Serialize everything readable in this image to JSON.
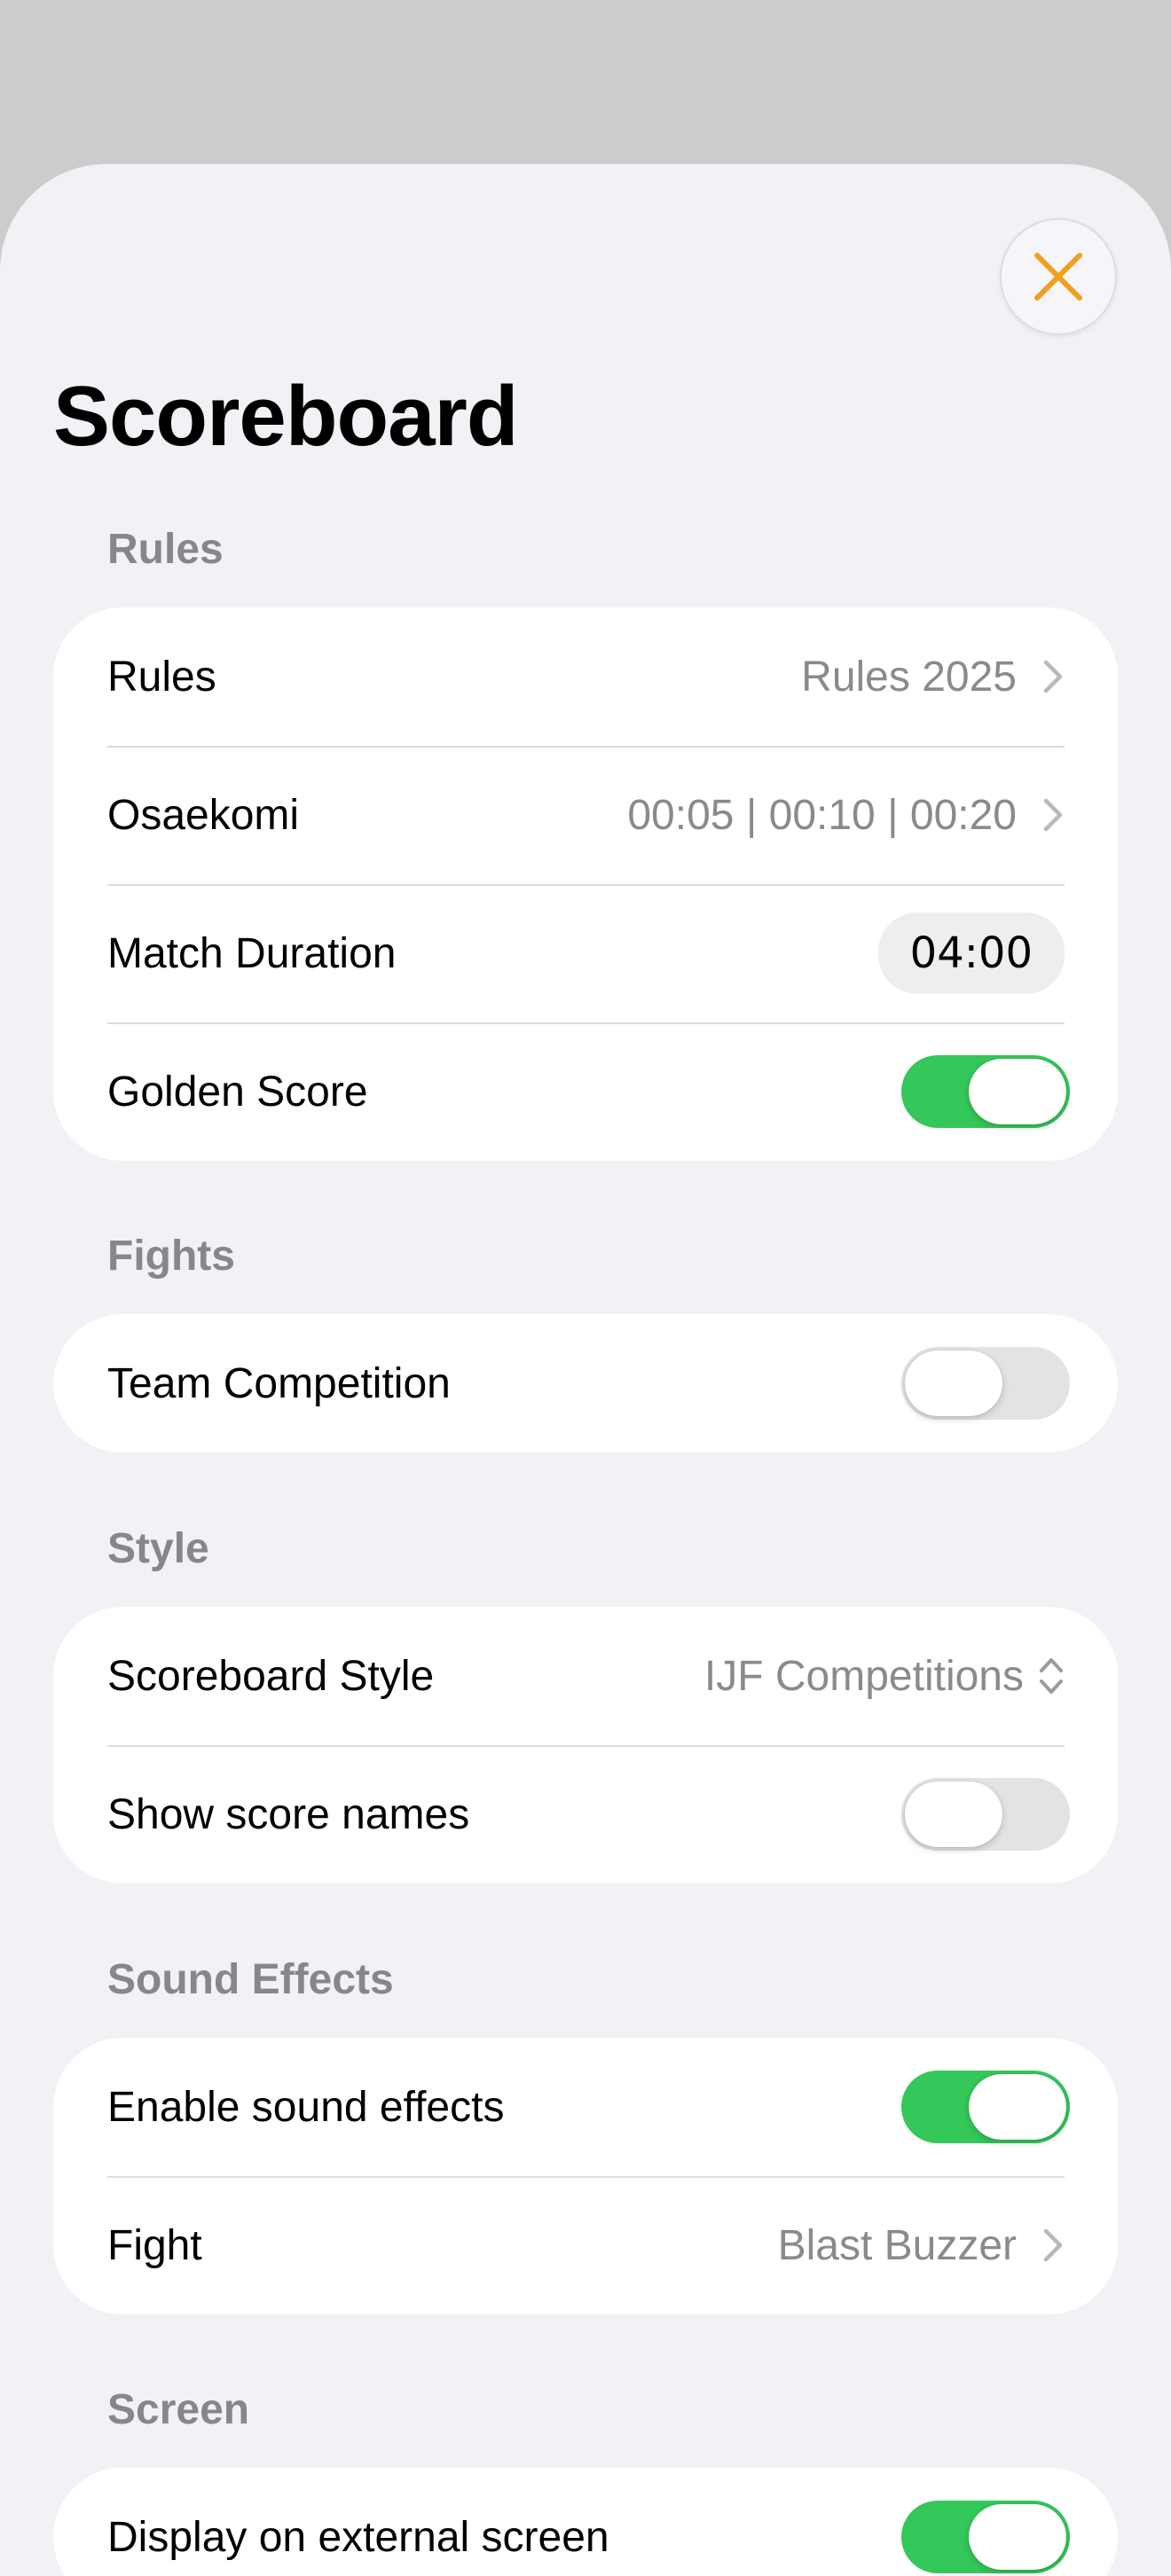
{
  "title": "Scoreboard",
  "close_icon": "xmark-icon",
  "colors": {
    "accent": "#f0a020",
    "toggle_on": "#34c759",
    "toggle_off": "#e3e3e6",
    "background": "#f1f1f6",
    "secondary_text": "#8a8a8e"
  },
  "sections": {
    "rules": {
      "header": "Rules",
      "rules_row": {
        "label": "Rules",
        "value": "Rules 2025"
      },
      "osaekomi_row": {
        "label": "Osaekomi",
        "value": "00:05 | 00:10 | 00:20"
      },
      "match_duration_row": {
        "label": "Match Duration",
        "value": "04:00"
      },
      "golden_score_row": {
        "label": "Golden Score",
        "on": true
      }
    },
    "fights": {
      "header": "Fights",
      "team_competition_row": {
        "label": "Team Competition",
        "on": false
      }
    },
    "style": {
      "header": "Style",
      "scoreboard_style_row": {
        "label": "Scoreboard Style",
        "value": "IJF Competitions"
      },
      "show_score_names_row": {
        "label": "Show score names",
        "on": false
      }
    },
    "sound": {
      "header": "Sound Effects",
      "enable_sound_row": {
        "label": "Enable sound effects",
        "on": true
      },
      "fight_row": {
        "label": "Fight",
        "value": "Blast Buzzer"
      }
    },
    "screen": {
      "header": "Screen",
      "external_screen_row": {
        "label": "Display on external screen",
        "on": true
      }
    }
  }
}
